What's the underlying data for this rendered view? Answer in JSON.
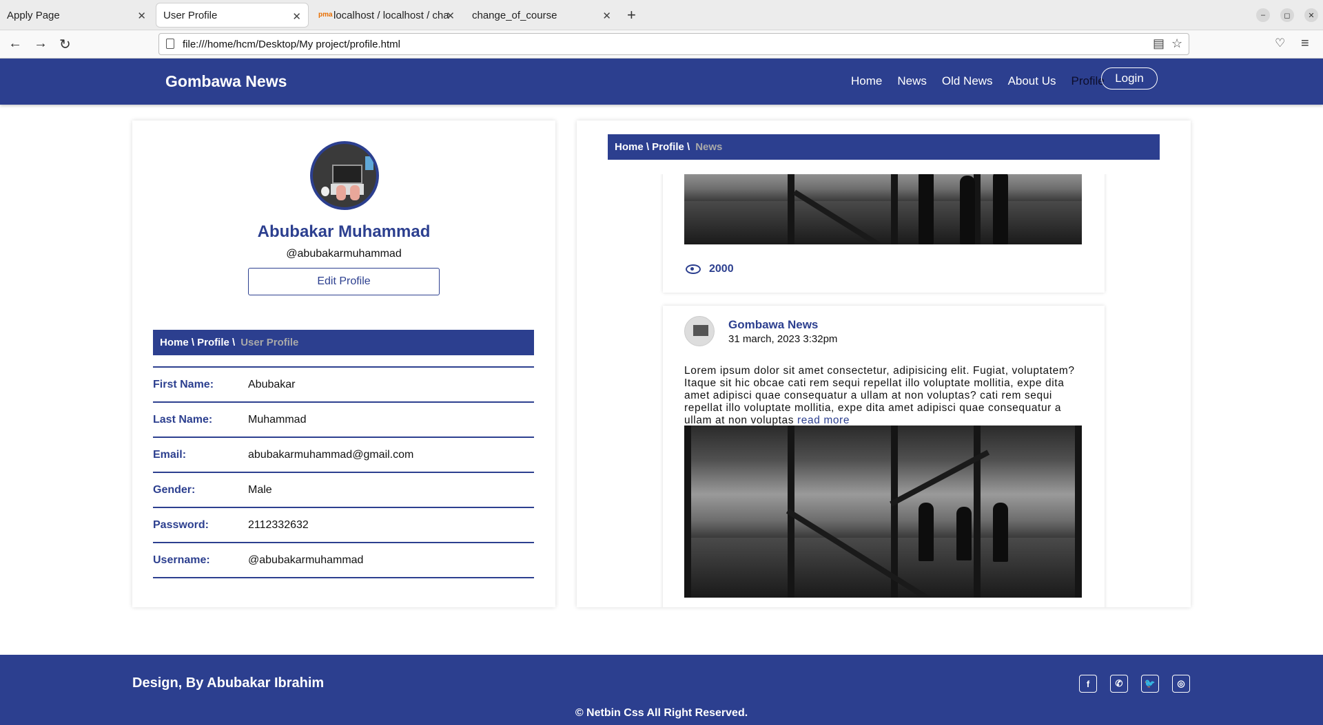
{
  "browser": {
    "tabs": [
      {
        "title": "Apply Page"
      },
      {
        "title": "User Profile"
      },
      {
        "title": "localhost / localhost / cha"
      },
      {
        "title": "change_of_course"
      }
    ],
    "url": "file:///home/hcm/Desktop/My project/profile.html"
  },
  "header": {
    "brand": "Gombawa News",
    "menu": [
      "Home",
      "News",
      "Old News",
      "About Us",
      "Profile"
    ],
    "login": "Login"
  },
  "profile": {
    "name": "Abubakar Muhammad",
    "username": "@abubakarmuhammad",
    "edit_button": "Edit Profile",
    "breadcrumb": {
      "path": "Home \\ Profile \\",
      "current": "User Profile"
    },
    "fields": [
      {
        "label": "First Name:",
        "value": "Abubakar"
      },
      {
        "label": "Last Name:",
        "value": "Muhammad"
      },
      {
        "label": "Email:",
        "value": "abubakarmuhammad@gmail.com"
      },
      {
        "label": "Gender:",
        "value": "Male"
      },
      {
        "label": "Password:",
        "value": "2112332632"
      },
      {
        "label": "Username:",
        "value": "@abubakarmuhammad"
      }
    ]
  },
  "news": {
    "breadcrumb": {
      "path": "Home \\ Profile \\",
      "current": "News"
    },
    "post1": {
      "views": "2000"
    },
    "post2": {
      "author": "Gombawa News",
      "date": "31 march, 2023 3:32pm",
      "text": "Lorem ipsum dolor sit amet consectetur, adipisicing elit. Fugiat, voluptatem? Itaque sit hic obcae cati rem sequi repellat illo voluptate mollitia, expe dita amet adipisci quae consequatur a ullam at non voluptas? cati rem sequi repellat illo voluptate mollitia, expe dita amet adipisci quae consequatur a ullam at non voluptas",
      "read_more": "read more"
    }
  },
  "footer": {
    "design": "Design, By Abubakar Ibrahim",
    "copyright": "© Netbin Css All Right Reserved.",
    "social_icons": [
      "facebook-icon",
      "whatsapp-icon",
      "twitter-icon",
      "instagram-icon"
    ]
  },
  "colors": {
    "primary": "#2c3f8f",
    "muted": "#a9a9a9"
  }
}
